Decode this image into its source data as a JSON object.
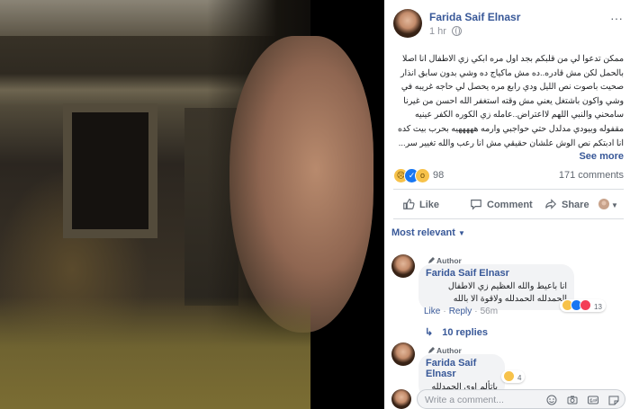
{
  "post": {
    "author": "Farida Saif Elnasr",
    "time": "1 hr",
    "text": "ممكن تدعوا لي من قلبكم بجد اول مره ابكي زي الاطفال انا اصلا بالحمل لكن مش قادره..ده مش ماكياج ده وشي بدون سابق انذار صحيت باصوت نص الليل ودي رابع مره يحصل لي حاجه غريبه في وشي واكون باشتغل يعني مش وقته استغفر الله احسن من غيرنا سامحني والنبي اللهم لااعتراض..عامله زي الكوره الكفر عينيه مقفوله وبيودي مدلدل حتي حواجبي وارمه هههههيه بحرب بيت كده انا ادبتكم نص الوش علشان حقيقي مش انا رعب والله تغيير سر...",
    "see_more": "See more",
    "reaction_count": "98",
    "comment_count": "171 comments",
    "actions": {
      "like": "Like",
      "comment": "Comment",
      "share": "Share"
    }
  },
  "comments_section": {
    "sort_label": "Most relevant",
    "comments": [
      {
        "author_tag": "Author",
        "name": "Farida Saif Elnasr",
        "text": "انا باعيط والله العظيم زي الاطفال الحمدلله الحمدلله ولاقوة الا بالله",
        "reaction_count": "13",
        "like_label": "Like",
        "reply_label": "Reply",
        "time": "56m"
      },
      {
        "author_tag": "Author",
        "name": "Farida Saif Elnasr",
        "text": "باتألم اوي الحمدلله",
        "reaction_count": "4"
      }
    ],
    "replies_label": "10 replies",
    "write_placeholder": "Write a comment..."
  },
  "icons": {
    "globe": "globe-icon",
    "more": "more-options-icon",
    "like": "thumbs-up-icon",
    "comment": "comment-bubble-icon",
    "share": "share-arrow-icon",
    "author_badge": "pencil-icon",
    "emoji": "emoji-icon",
    "camera": "camera-icon",
    "gif": "gif-icon",
    "sticker": "sticker-icon"
  },
  "colors": {
    "link": "#385898",
    "secondary_text": "#606770",
    "bubble": "#f2f3f5",
    "divider": "#dadde1"
  }
}
